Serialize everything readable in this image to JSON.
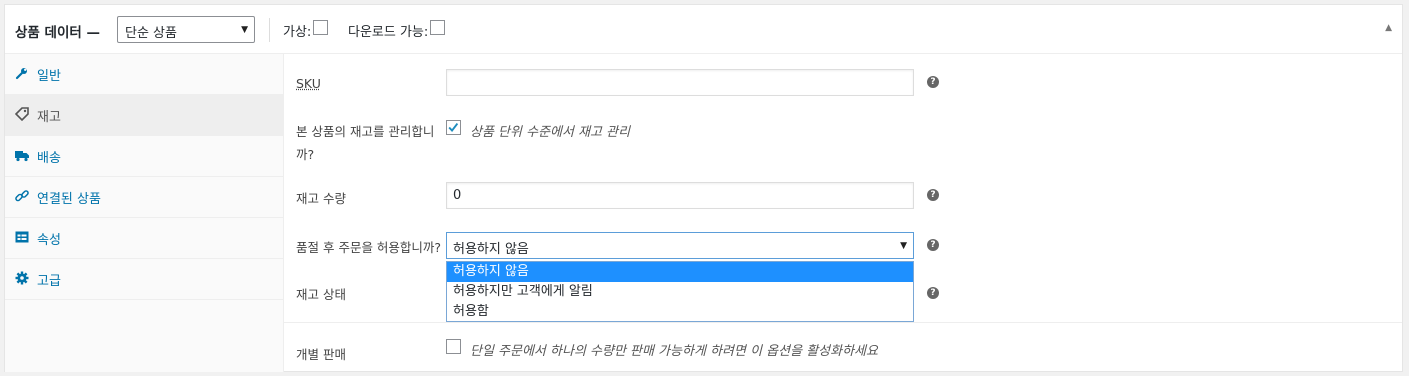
{
  "header": {
    "title": "상품 데이터 —",
    "product_type": "단순 상품",
    "virtual_label": "가상:",
    "downloadable_label": "다운로드 가능:",
    "virtual_checked": false,
    "downloadable_checked": false
  },
  "tabs": [
    {
      "label": "일반",
      "icon": "wrench-icon",
      "active": false
    },
    {
      "label": "재고",
      "icon": "tag-icon",
      "active": true
    },
    {
      "label": "배송",
      "icon": "truck-icon",
      "active": false
    },
    {
      "label": "연결된 상품",
      "icon": "link-icon",
      "active": false
    },
    {
      "label": "속성",
      "icon": "table-icon",
      "active": false
    },
    {
      "label": "고급",
      "icon": "gear-icon",
      "active": false
    }
  ],
  "inventory": {
    "sku_label": "SKU",
    "sku_value": "",
    "manage_stock_label_line1": "본 상품의 재고를 관리합니",
    "manage_stock_label_line2": "까?",
    "manage_stock_checked": true,
    "manage_stock_desc": "상품 단위 수준에서 재고 관리",
    "stock_qty_label": "재고 수량",
    "stock_qty_value": "0",
    "backorders_label": "품절 후 주문을 허용합니까?",
    "backorders_value": "허용하지 않음",
    "backorders_options": [
      "허용하지 않음",
      "허용하지만 고객에게 알림",
      "허용함"
    ],
    "stock_status_label": "재고 상태",
    "sold_individually_label": "개별 판매",
    "sold_individually_checked": false,
    "sold_individually_desc": "단일 주문에서 하나의 수량만 판매 가능하게 하려면 이 옵션을 활성화하세요"
  },
  "colors": {
    "accent": "#0073aa",
    "highlight": "#1e90ff"
  }
}
